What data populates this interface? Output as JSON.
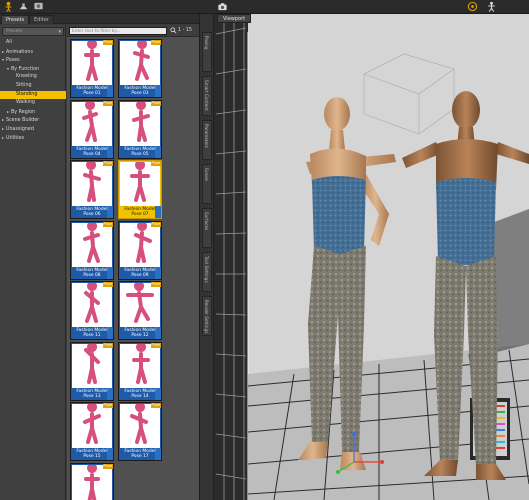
{
  "toolbar": {
    "icons": [
      "pose-tool-icon",
      "figure-tool-icon",
      "render-icon",
      "camera-icon",
      "help-icon",
      "figure-settings-icon"
    ]
  },
  "left_pane": {
    "tabs": [
      {
        "label": "Presets"
      },
      {
        "label": "Editor"
      }
    ],
    "tree_search_placeholder": "Presets",
    "tree": [
      {
        "label": "All",
        "indent": 0,
        "arrow": ""
      },
      {
        "label": "Animations",
        "indent": 0,
        "arrow": "▸"
      },
      {
        "label": "Poses",
        "indent": 0,
        "arrow": "▾"
      },
      {
        "label": "By Function",
        "indent": 1,
        "arrow": "▾"
      },
      {
        "label": "Kneeling",
        "indent": 2,
        "arrow": ""
      },
      {
        "label": "Sitting",
        "indent": 2,
        "arrow": ""
      },
      {
        "label": "Standing",
        "indent": 2,
        "arrow": "",
        "selected": true
      },
      {
        "label": "Walking",
        "indent": 2,
        "arrow": ""
      },
      {
        "label": "By Region",
        "indent": 1,
        "arrow": "▸"
      },
      {
        "label": "Scene Builder",
        "indent": 0,
        "arrow": "▸"
      },
      {
        "label": "Unassigned",
        "indent": 0,
        "arrow": "▸"
      },
      {
        "label": "Utilities",
        "indent": 0,
        "arrow": "▸"
      }
    ],
    "filter_placeholder": "Enter text to filter by...",
    "filter_count": "1 - 15",
    "items": [
      {
        "label": "Fashion Model Pose 01",
        "badge": "Pose"
      },
      {
        "label": "Fashion Model Pose 03",
        "badge": "Pose"
      },
      {
        "label": "Fashion Model Pose 04",
        "badge": "Pose"
      },
      {
        "label": "Fashion Model Pose 05",
        "badge": "Pose"
      },
      {
        "label": "Fashion Model Pose 06",
        "badge": "Pose"
      },
      {
        "label": "Fashion Model Pose 07",
        "badge": "Pose",
        "selected": true
      },
      {
        "label": "Fashion Model Pose 08",
        "badge": "Pose"
      },
      {
        "label": "Fashion Model Pose 09",
        "badge": "Pose"
      },
      {
        "label": "Fashion Model Pose 11",
        "badge": "Pose"
      },
      {
        "label": "Fashion Model Pose 12",
        "badge": "Pose"
      },
      {
        "label": "Fashion Model Pose 13",
        "badge": "Pose"
      },
      {
        "label": "Fashion Model Pose 14",
        "badge": "Pose"
      },
      {
        "label": "Fashion Model Pose 15",
        "badge": "Pose"
      },
      {
        "label": "Fashion Model Pose 17",
        "badge": "Pose"
      },
      {
        "label": "",
        "badge": "Pose"
      }
    ]
  },
  "side_tabs": [
    "Posing",
    "Smart Content",
    "Parameters",
    "Scene",
    "Surfaces",
    "Tool Settings",
    "Render Settings"
  ],
  "viewport": {
    "tab_label": "Viewport"
  },
  "colors": {
    "selected_accent": "#f4c000",
    "tile_blue": "#1e5aa8",
    "figure_pink": "#d64f7e"
  }
}
